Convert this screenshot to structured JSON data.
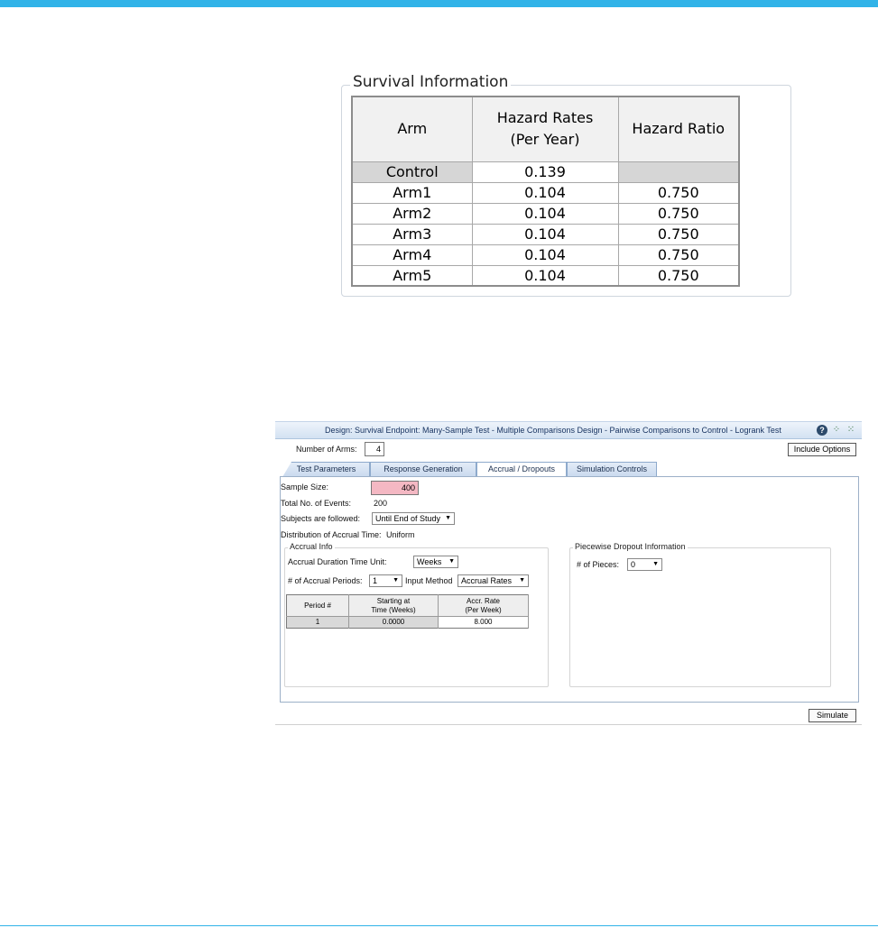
{
  "survival": {
    "legend": "Survival Information",
    "headers": [
      "Arm",
      "Hazard Rates\n(Per Year)",
      "Hazard Ratio"
    ],
    "header_lines": {
      "arm": "Arm",
      "rates_line1": "Hazard Rates",
      "rates_line2": "(Per Year)",
      "ratio": "Hazard Ratio"
    },
    "rows": [
      {
        "arm": "Control",
        "rate": "0.139",
        "ratio": ""
      },
      {
        "arm": "Arm1",
        "rate": "0.104",
        "ratio": "0.750"
      },
      {
        "arm": "Arm2",
        "rate": "0.104",
        "ratio": "0.750"
      },
      {
        "arm": "Arm3",
        "rate": "0.104",
        "ratio": "0.750"
      },
      {
        "arm": "Arm4",
        "rate": "0.104",
        "ratio": "0.750"
      },
      {
        "arm": "Arm5",
        "rate": "0.104",
        "ratio": "0.750"
      }
    ]
  },
  "dialog": {
    "title": "Design: Survival Endpoint: Many-Sample Test - Multiple Comparisons Design - Pairwise Comparisons to Control - Logrank Test",
    "number_of_arms_label": "Number of Arms:",
    "number_of_arms_value": "4",
    "include_options_label": "Include Options",
    "tabs": [
      "Test Parameters",
      "Response Generation",
      "Accrual / Dropouts",
      "Simulation Controls"
    ],
    "active_tab": "Accrual / Dropouts",
    "sample_size_label": "Sample Size:",
    "sample_size_value": "400",
    "total_events_label": "Total No. of Events:",
    "total_events_value": "200",
    "followed_label": "Subjects are followed:",
    "followed_value": "Until End of Study",
    "distribution_label": "Distribution of Accrual Time:",
    "distribution_value": "Uniform",
    "accrual_info": {
      "legend": "Accrual Info",
      "duration_unit_label": "Accrual Duration Time Unit:",
      "duration_unit_value": "Weeks",
      "periods_label": "# of Accrual Periods:",
      "periods_value": "1",
      "input_method_label": "Input Method",
      "input_method_value": "Accrual Rates",
      "table": {
        "headers": {
          "period": "Period #",
          "start_line1": "Starting at",
          "start_line2": "Time (Weeks)",
          "rate_line1": "Accr. Rate",
          "rate_line2": "(Per Week)"
        },
        "rows": [
          {
            "period": "1",
            "start": "0.0000",
            "rate": "8.000"
          }
        ]
      }
    },
    "dropout": {
      "legend": "Piecewise Dropout Information",
      "pieces_label": "# of Pieces:",
      "pieces_value": "0"
    },
    "simulate_label": "Simulate"
  },
  "colors": {
    "accent_bar": "#31b3e8",
    "sample_size_bg": "#f4b8c3",
    "title_bar": "#d3e2f2"
  }
}
